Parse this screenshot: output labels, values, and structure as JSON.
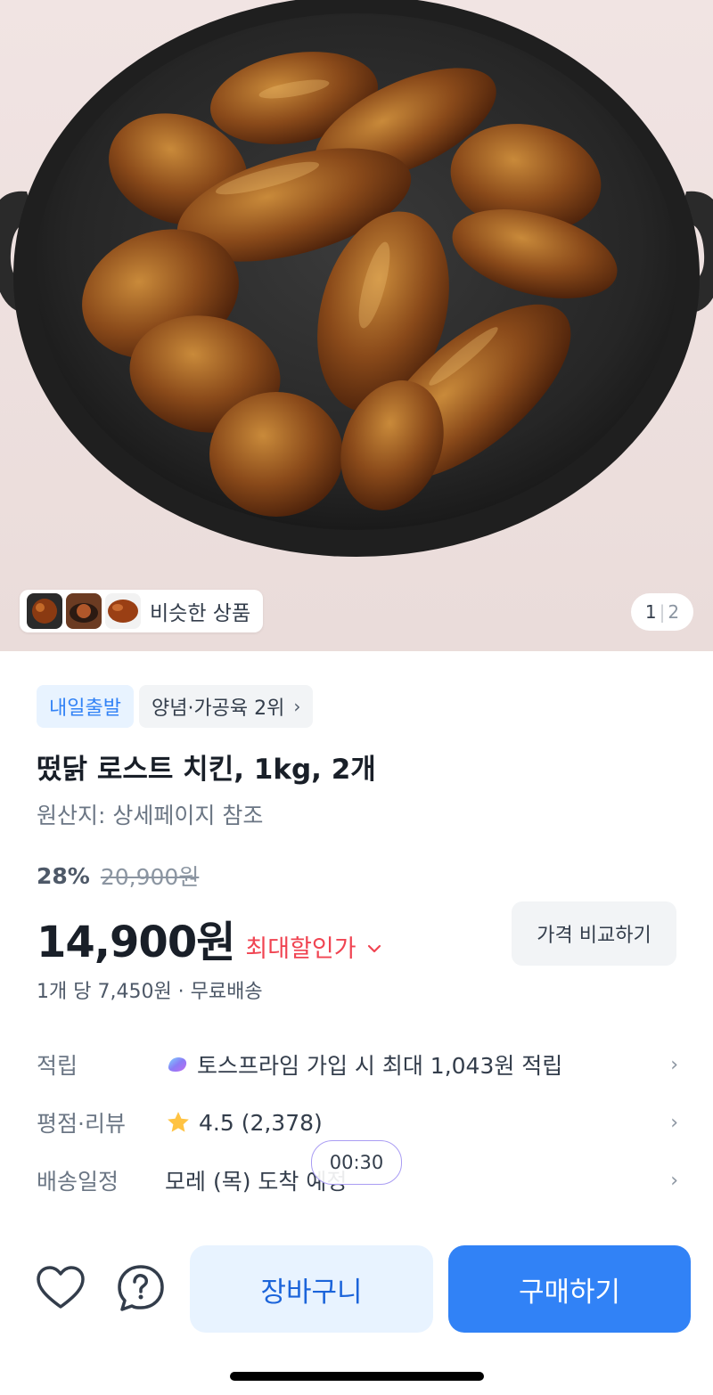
{
  "hero": {
    "similar_label": "비슷한 상품",
    "page_current": "1",
    "page_separator": "|",
    "page_total": "2"
  },
  "badges": {
    "delivery": "내일출발",
    "ranking": "양념·가공육 2위"
  },
  "product": {
    "title": "떴닭 로스트 치킨, 1kg, 2개",
    "origin": "원산지: 상세페이지 참조",
    "discount_rate": "28%",
    "original_price": "20,900원",
    "price": "14,900원",
    "max_discount_label": "최대할인가",
    "compare_button": "가격 비교하기",
    "unit_line": "1개 당 7,450원 · 무료배송"
  },
  "info_rows": [
    {
      "key": "적립",
      "value": "토스프라임 가입 시 최대 1,043원 적립",
      "icon": "toss-prime-icon"
    },
    {
      "key": "평점·리뷰",
      "value": "4.5 (2,378)",
      "icon": "star-icon"
    },
    {
      "key": "배송일정",
      "value": "모레 (목) 도착 예정",
      "icon": ""
    }
  ],
  "timer": "00:30",
  "actions": {
    "cart": "장바구니",
    "buy": "구매하기"
  },
  "colors": {
    "accent_blue": "#3182f6",
    "sale_red": "#f04452",
    "badge_blue_bg": "#e8f3ff",
    "star": "#ffc342"
  }
}
